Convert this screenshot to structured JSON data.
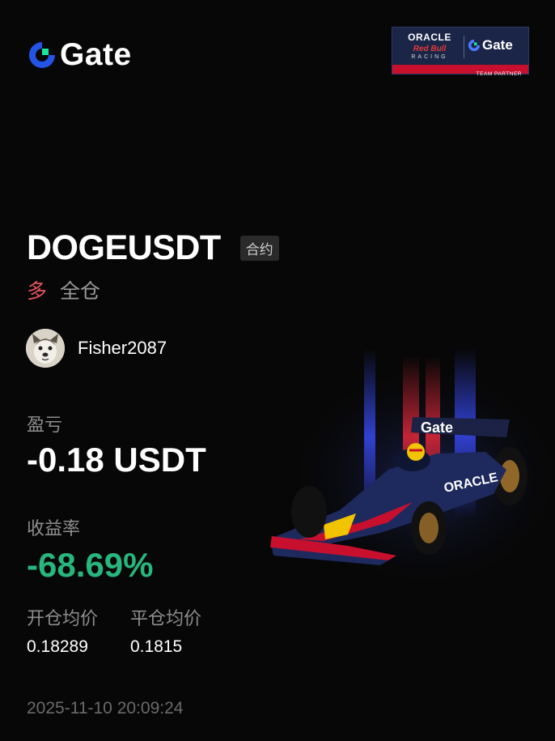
{
  "brand": {
    "name": "Gate",
    "mark_icon": "gate-logo-icon",
    "accent_color": "#2354e6",
    "accent_secondary": "#17e6a1"
  },
  "partner_badge": {
    "oracle": "ORACLE",
    "red_bull": "Red Bull",
    "racing": "RACING",
    "gate": "Gate",
    "strip": "TEAM PARTNER"
  },
  "position": {
    "pair": "DOGEUSDT",
    "type_tag": "合约",
    "side": "多",
    "margin_mode": "全仓"
  },
  "user": {
    "name": "Fisher2087",
    "avatar_icon": "dog-avatar-icon"
  },
  "stats": {
    "pnl_label": "盈亏",
    "pnl_value": "-0.18 USDT",
    "roi_label": "收益率",
    "roi_value": "-68.69%",
    "open_avg_label": "开仓均价",
    "close_avg_label": "平仓均价",
    "open_avg_price": "0.18289",
    "close_avg_price": "0.1815"
  },
  "timestamp": "2025-11-10 20:09:24",
  "colors": {
    "background": "#070707",
    "loss_side": "#e2545c",
    "roi_positive_green": "#27b67e",
    "muted_label": "#8e8e8e"
  }
}
